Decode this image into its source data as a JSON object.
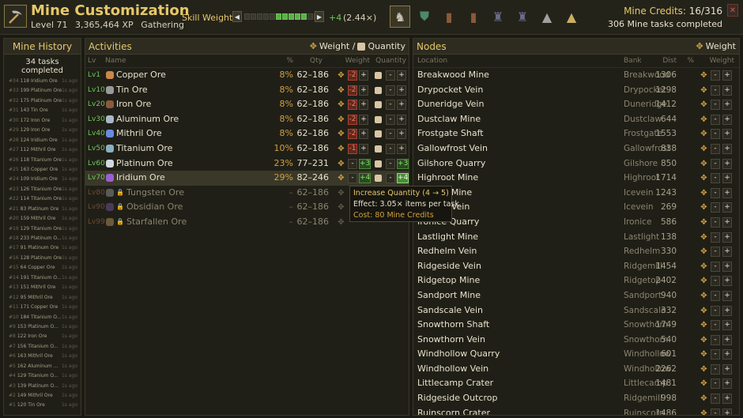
{
  "header": {
    "title": "Mine Customization",
    "level": "Level 71",
    "xp": "3,365,464 XP",
    "skill": "Gathering",
    "skill_weight_label": "Skill Weight:",
    "skill_weight_plus": "+4",
    "skill_weight_mult": "(2.44×)",
    "skill_weight_segments_on": 5,
    "skill_weight_segments_total": 12,
    "credits_label": "Mine Credits:",
    "credits_value": "16/316",
    "tasks_completed": "306 Mine tasks completed",
    "close_icon": "close-icon"
  },
  "tools": [
    {
      "icon": "helmet-icon",
      "selected": true
    },
    {
      "icon": "tunic-icon",
      "selected": false
    },
    {
      "icon": "legs-icon",
      "selected": false
    },
    {
      "icon": "chaps-icon",
      "selected": false
    },
    {
      "icon": "armor-icon",
      "selected": false
    },
    {
      "icon": "armor-icon",
      "selected": false
    },
    {
      "icon": "robe-icon",
      "selected": false
    },
    {
      "icon": "robe-icon",
      "selected": false
    }
  ],
  "history": {
    "title": "Mine History",
    "count": "34 tasks completed",
    "rows": [
      {
        "n": "#34",
        "text": "118 Iridium Ore",
        "ago": "1s ago"
      },
      {
        "n": "#33",
        "text": "199 Platinum Ore",
        "ago": "1s ago"
      },
      {
        "n": "#32",
        "text": "175 Platinum Ore",
        "ago": "1s ago"
      },
      {
        "n": "#31",
        "text": "143 Tin Ore",
        "ago": "1s ago"
      },
      {
        "n": "#30",
        "text": "172 Iron Ore",
        "ago": "1s ago"
      },
      {
        "n": "#29",
        "text": "129 Iron Ore",
        "ago": "1s ago"
      },
      {
        "n": "#28",
        "text": "124 Iridium Ore",
        "ago": "1s ago"
      },
      {
        "n": "#27",
        "text": "112 Mithril Ore",
        "ago": "1s ago"
      },
      {
        "n": "#26",
        "text": "118 Titanium Ore",
        "ago": "1s ago"
      },
      {
        "n": "#25",
        "text": "163 Copper Ore",
        "ago": "1s ago"
      },
      {
        "n": "#24",
        "text": "109 Iridium Ore",
        "ago": "1s ago"
      },
      {
        "n": "#23",
        "text": "126 Titanium Ore",
        "ago": "1s ago"
      },
      {
        "n": "#22",
        "text": "114 Titanium Ore",
        "ago": "1s ago"
      },
      {
        "n": "#21",
        "text": "83 Platinum Ore",
        "ago": "1s ago"
      },
      {
        "n": "#20",
        "text": "159 Mithril Ore",
        "ago": "1s ago"
      },
      {
        "n": "#19",
        "text": "129 Titanium Ore",
        "ago": "1s ago"
      },
      {
        "n": "#18",
        "text": "233 Platinum O...",
        "ago": "1s ago"
      },
      {
        "n": "#17",
        "text": "91 Platinum Ore",
        "ago": "1s ago"
      },
      {
        "n": "#16",
        "text": "128 Platinum Ore",
        "ago": "1s ago"
      },
      {
        "n": "#15",
        "text": "64 Copper Ore",
        "ago": "1s ago"
      },
      {
        "n": "#14",
        "text": "191 Titanium O...",
        "ago": "1s ago"
      },
      {
        "n": "#13",
        "text": "151 Mithril Ore",
        "ago": "1s ago"
      },
      {
        "n": "#12",
        "text": "95 Mithril Ore",
        "ago": "1s ago"
      },
      {
        "n": "#11",
        "text": "171 Copper Ore",
        "ago": "1s ago"
      },
      {
        "n": "#10",
        "text": "184 Titanium O...",
        "ago": "1s ago"
      },
      {
        "n": "#9",
        "text": "153 Platinum O...",
        "ago": "1s ago"
      },
      {
        "n": "#8",
        "text": "122 Iron Ore",
        "ago": "1s ago"
      },
      {
        "n": "#7",
        "text": "156 Titanium O...",
        "ago": "1s ago"
      },
      {
        "n": "#6",
        "text": "163 Mithril Ore",
        "ago": "1s ago"
      },
      {
        "n": "#5",
        "text": "162 Aluminum ...",
        "ago": "1s ago"
      },
      {
        "n": "#4",
        "text": "129 Titanium O...",
        "ago": "1s ago"
      },
      {
        "n": "#3",
        "text": "139 Platinum O...",
        "ago": "1s ago"
      },
      {
        "n": "#2",
        "text": "149 Mithril Ore",
        "ago": "1s ago"
      },
      {
        "n": "#1",
        "text": "120 Tin Ore",
        "ago": "1s ago"
      }
    ]
  },
  "activities": {
    "title": "Activities",
    "header_right": "Weight / ",
    "header_right2": "Quantity",
    "col_lv": "Lv",
    "col_name": "Name",
    "col_pct": "%",
    "col_qty": "Qty",
    "col_weight": "Weight",
    "col_quantity": "Quantity",
    "rows": [
      {
        "lv": "Lv1",
        "name": "Copper Ore",
        "pct": "8%",
        "qty": "62–186",
        "w": "-2",
        "q": "",
        "color": "#c8884a",
        "locked": false,
        "hl": false
      },
      {
        "lv": "Lv10",
        "name": "Tin Ore",
        "pct": "8%",
        "qty": "62–186",
        "w": "-2",
        "q": "",
        "color": "#9a9a9a",
        "locked": false,
        "hl": false
      },
      {
        "lv": "Lv20",
        "name": "Iron Ore",
        "pct": "8%",
        "qty": "62–186",
        "w": "-2",
        "q": "",
        "color": "#8a5a3a",
        "locked": false,
        "hl": false
      },
      {
        "lv": "Lv30",
        "name": "Aluminum Ore",
        "pct": "8%",
        "qty": "62–186",
        "w": "-2",
        "q": "",
        "color": "#a8b8c8",
        "locked": false,
        "hl": false
      },
      {
        "lv": "Lv40",
        "name": "Mithril Ore",
        "pct": "8%",
        "qty": "62–186",
        "w": "-2",
        "q": "",
        "color": "#6a8ae0",
        "locked": false,
        "hl": false
      },
      {
        "lv": "Lv50",
        "name": "Titanium Ore",
        "pct": "10%",
        "qty": "62–186",
        "w": "-1",
        "q": "",
        "color": "#8ab0c0",
        "locked": false,
        "hl": false
      },
      {
        "lv": "Lv60",
        "name": "Platinum Ore",
        "pct": "23%",
        "qty": "77–231",
        "w": "+3",
        "q": "+3",
        "color": "#d0d8e0",
        "locked": false,
        "hl": false
      },
      {
        "lv": "Lv70",
        "name": "Iridium Ore",
        "pct": "29%",
        "qty": "82–246",
        "w": "+4",
        "q": "+4",
        "color": "#9a60d0",
        "locked": false,
        "hl": true
      },
      {
        "lv": "Lv80",
        "name": "Tungsten Ore",
        "pct": "–",
        "qty": "62–186",
        "w": "",
        "q": "",
        "color": "#5a5a5a",
        "locked": true,
        "hl": false
      },
      {
        "lv": "Lv90",
        "name": "Obsidian Ore",
        "pct": "–",
        "qty": "62–186",
        "w": "",
        "q": "",
        "color": "#4a3a5a",
        "locked": true,
        "hl": false
      },
      {
        "lv": "Lv99",
        "name": "Starfallen Ore",
        "pct": "–",
        "qty": "62–186",
        "w": "",
        "q": "",
        "color": "#6a5a3a",
        "locked": true,
        "hl": false
      }
    ]
  },
  "tooltip": {
    "title": "Increase Quantity (4 → 5)",
    "effect": "Effect: 3.05× items per task",
    "cost": "Cost: 80 Mine Credits"
  },
  "nodes": {
    "title": "Nodes",
    "header_right": "Weight",
    "col_location": "Location",
    "col_bank": "Bank",
    "col_dist": "Dist",
    "col_pct": "%",
    "col_weight": "Weight",
    "rows": [
      {
        "name": "Breakwood Mine",
        "bank": "Breakwood",
        "dist": "1306"
      },
      {
        "name": "Drypocket Vein",
        "bank": "Drypocket",
        "dist": "1298"
      },
      {
        "name": "Duneridge Vein",
        "bank": "Duneridge",
        "dist": "1412"
      },
      {
        "name": "Dustclaw Mine",
        "bank": "Dustclaw",
        "dist": "644"
      },
      {
        "name": "Frostgate Shaft",
        "bank": "Frostgate",
        "dist": "1553"
      },
      {
        "name": "Gallowfrost Vein",
        "bank": "Gallowfrost",
        "dist": "838"
      },
      {
        "name": "Gilshore Quarry",
        "bank": "Gilshore",
        "dist": "850"
      },
      {
        "name": "Highroot Mine",
        "bank": "Highroot",
        "dist": "1714"
      },
      {
        "name": "Icevein Mine",
        "bank": "Icevein",
        "dist": "1243"
      },
      {
        "name": "Icevein Vein",
        "bank": "Icevein",
        "dist": "269"
      },
      {
        "name": "Ironice Quarry",
        "bank": "Ironice",
        "dist": "586"
      },
      {
        "name": "Lastlight Mine",
        "bank": "Lastlight",
        "dist": "138"
      },
      {
        "name": "Redhelm Vein",
        "bank": "Redhelm",
        "dist": "330"
      },
      {
        "name": "Ridgeside Vein",
        "bank": "Ridgemill",
        "dist": "1454"
      },
      {
        "name": "Ridgetop Mine",
        "bank": "Ridgetop",
        "dist": "2402"
      },
      {
        "name": "Sandport Mine",
        "bank": "Sandport",
        "dist": "940"
      },
      {
        "name": "Sandscale Vein",
        "bank": "Sandscale",
        "dist": "332"
      },
      {
        "name": "Snowthorn Shaft",
        "bank": "Snowthorn",
        "dist": "1749"
      },
      {
        "name": "Snowthorn Vein",
        "bank": "Snowthorn",
        "dist": "540"
      },
      {
        "name": "Windhollow Quarry",
        "bank": "Windhollow",
        "dist": "601"
      },
      {
        "name": "Windhollow Vein",
        "bank": "Windhollow",
        "dist": "2262"
      },
      {
        "name": "Littlecamp Crater",
        "bank": "Littlecamp",
        "dist": "1481"
      },
      {
        "name": "Ridgeside Outcrop",
        "bank": "Ridgemill",
        "dist": "998"
      },
      {
        "name": "Ruinscorn Crater",
        "bank": "Ruinscorn",
        "dist": "1486"
      }
    ]
  }
}
